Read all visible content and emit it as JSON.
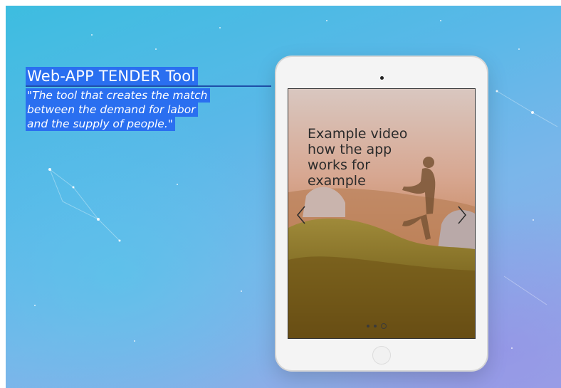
{
  "hero": {
    "title": "Web-APP TENDER Tool",
    "quote_lines": [
      "\"The tool that creates the match",
      "between the demand for labor",
      "and the supply of people.\""
    ]
  },
  "slider": {
    "caption": "Example video\nhow the app\nworks for\nexample",
    "prev_icon": "chevron-left-icon",
    "next_icon": "chevron-right-icon",
    "dot_count": 3,
    "active_dot": 3
  },
  "colors": {
    "highlight": "#2a6ff0",
    "background_start": "#3dbde0",
    "background_end": "#9aa6e6"
  }
}
